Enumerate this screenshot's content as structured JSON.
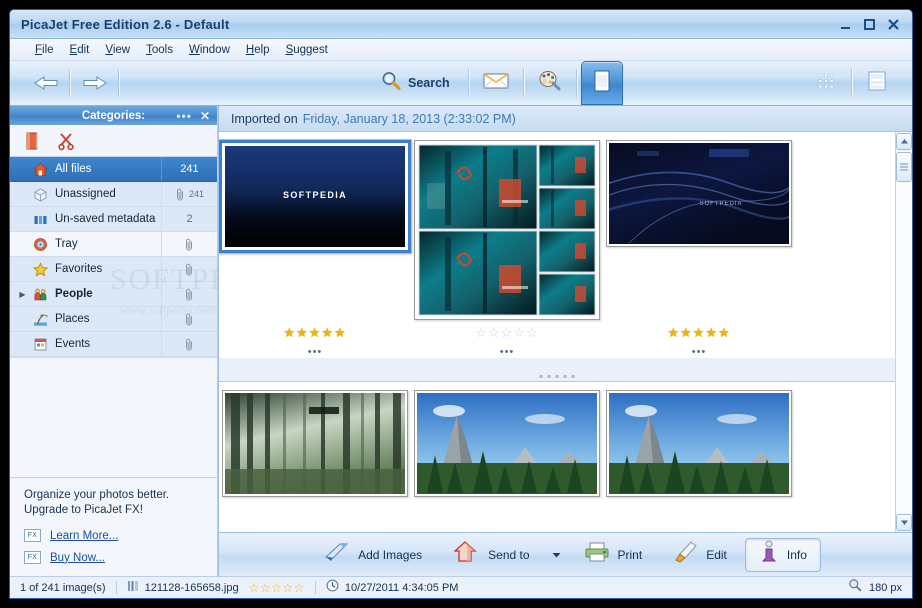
{
  "window": {
    "title": "PicaJet Free Edition 2.6  - Default",
    "controls": [
      {
        "name": "minimize",
        "label": "_"
      },
      {
        "name": "maximize",
        "label": "□"
      },
      {
        "name": "close",
        "label": "✕"
      }
    ]
  },
  "menu": [
    {
      "label": "File",
      "accel": "F"
    },
    {
      "label": "Edit",
      "accel": "E"
    },
    {
      "label": "View",
      "accel": "V"
    },
    {
      "label": "Tools",
      "accel": "T"
    },
    {
      "label": "Window",
      "accel": "W"
    },
    {
      "label": "Help",
      "accel": "H"
    },
    {
      "label": "Suggest",
      "accel": "S"
    }
  ],
  "toolbar": {
    "back_icon": "arrow-left-icon",
    "forward_icon": "arrow-right-icon",
    "search_label": "Search",
    "search_icon": "magnifier-icon",
    "email_icon": "envelope-icon",
    "slideshow_icon": "palette-icon",
    "view_single_icon": "single-view-icon",
    "view_grid_icon": "grid-view-icon",
    "view_filmstrip_icon": "filmstrip-view-icon"
  },
  "sidebar": {
    "header_title": "Categories:",
    "header_menu_label": "•••",
    "header_close_label": "✕",
    "tools": [
      {
        "name": "new-category-icon"
      },
      {
        "name": "scissors-icon"
      }
    ],
    "items": [
      {
        "label": "All files",
        "count": "241",
        "icon": "home-icon",
        "selected": true,
        "clip": false,
        "bold": false,
        "expandable": false,
        "small": false
      },
      {
        "label": "Unassigned",
        "count": "241",
        "icon": "box-icon",
        "selected": false,
        "clip": true,
        "bold": false,
        "expandable": false,
        "small": true
      },
      {
        "label": "Un-saved metadata",
        "count": "2",
        "icon": "bars-icon",
        "selected": false,
        "clip": false,
        "bold": false,
        "expandable": false,
        "small": false
      },
      {
        "label": "Tray",
        "count": "",
        "icon": "tray-icon",
        "selected": false,
        "clip": true,
        "bold": false,
        "expandable": false,
        "small": false
      },
      {
        "label": "Favorites",
        "count": "",
        "icon": "star-icon",
        "selected": false,
        "clip": true,
        "bold": false,
        "expandable": false,
        "small": false
      },
      {
        "label": "People",
        "count": "",
        "icon": "people-icon",
        "selected": false,
        "clip": true,
        "bold": true,
        "expandable": true,
        "small": false
      },
      {
        "label": "Places",
        "count": "",
        "icon": "places-icon",
        "selected": false,
        "clip": true,
        "bold": false,
        "expandable": false,
        "small": false
      },
      {
        "label": "Events",
        "count": "",
        "icon": "events-icon",
        "selected": false,
        "clip": true,
        "bold": false,
        "expandable": false,
        "small": false
      }
    ],
    "watermark_big": "SOFTPEDIA",
    "watermark_small": "www.softpedia.com",
    "promo": {
      "line1": "Organize your photos better.",
      "line2": "Upgrade to PicaJet FX!",
      "badge": "FX",
      "learn_more": "Learn More...",
      "buy_now": "Buy Now..."
    }
  },
  "content": {
    "header_static": "Imported on",
    "header_date": "Friday, January 18, 2013 (2:33:02 PM)",
    "row1": [
      {
        "name": "thumb-softpedia-splash",
        "rating": 5,
        "caption": "•••",
        "selected": true,
        "art": "splash"
      },
      {
        "name": "thumb-forest-collage",
        "rating": 0,
        "caption": "•••",
        "selected": false,
        "art": "collage"
      },
      {
        "name": "thumb-blue-abstract",
        "rating": 5,
        "caption": "•••",
        "selected": false,
        "art": "abstract"
      }
    ],
    "row2": [
      {
        "name": "thumb-misty-forest",
        "art": "forest"
      },
      {
        "name": "thumb-mountain-a",
        "art": "mountain"
      },
      {
        "name": "thumb-mountain-b",
        "art": "mountain"
      }
    ]
  },
  "bottombar": [
    {
      "label": "Add Images",
      "icon": "add-images-icon",
      "pressed": false,
      "caret": false
    },
    {
      "label": "Send to",
      "icon": "send-to-icon",
      "pressed": false,
      "caret": true
    },
    {
      "label": "Print",
      "icon": "printer-icon",
      "pressed": false,
      "caret": false
    },
    {
      "label": "Edit",
      "icon": "brush-icon",
      "pressed": false,
      "caret": false
    },
    {
      "label": "Info",
      "icon": "info-icon",
      "pressed": true,
      "caret": false
    }
  ],
  "statusbar": {
    "count": "1 of 241 image(s)",
    "filename": "121128-165658.jpg",
    "stars": "☆☆☆☆☆",
    "datetime": "10/27/2011 4:34:05 PM",
    "zoom": "180 px",
    "zoom_icon": "magnifier-small-icon",
    "clock_icon": "clock-icon",
    "file_icon": "filmstrip-small-icon"
  },
  "colors": {
    "accent": "#3f82c8",
    "title_text": "#1b3f6e",
    "selection": "#2f6fb6",
    "star_on": "#f0b400",
    "star_off": "#bed4ea",
    "link": "#1d4f9c"
  }
}
